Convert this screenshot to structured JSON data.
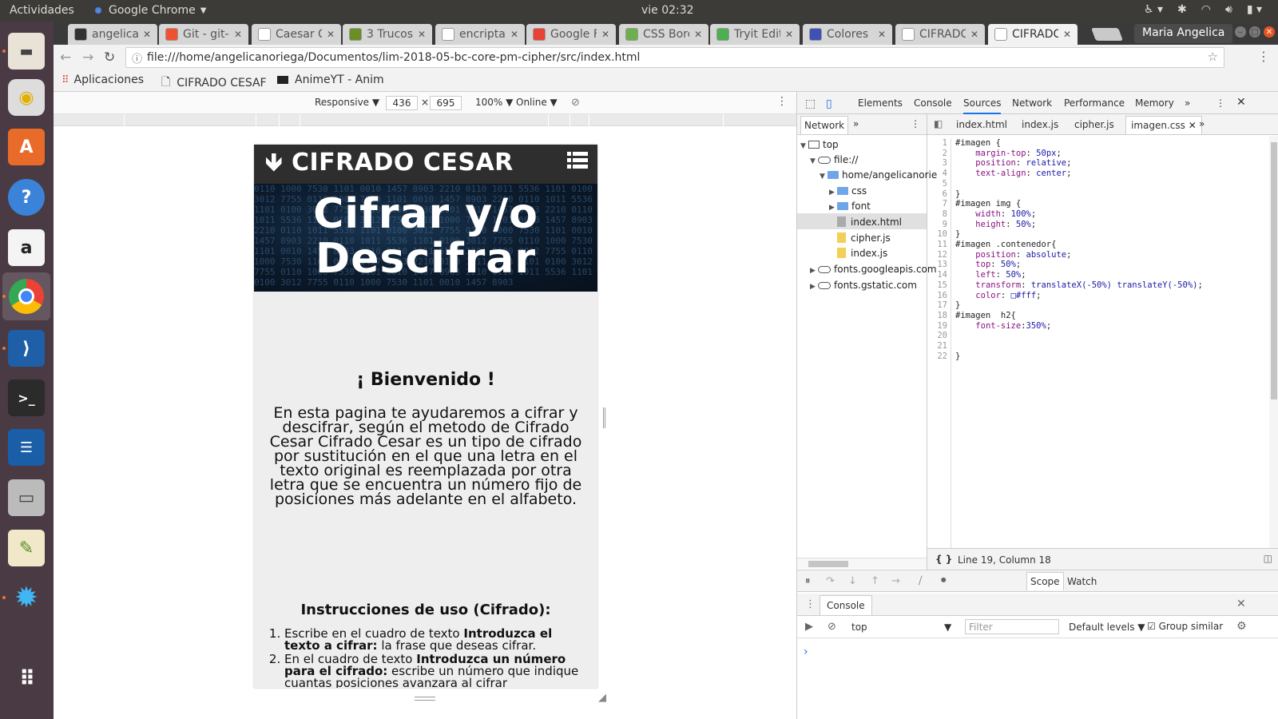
{
  "topbar": {
    "activities": "Actividades",
    "app_name": "Google Chrome",
    "clock": "vie 02:32"
  },
  "launcher": {
    "items": [
      "files-icon",
      "music-icon",
      "software-center-icon",
      "help-icon",
      "amazon-icon",
      "chrome-icon",
      "vscode-icon",
      "terminal-icon",
      "writer-icon",
      "scanner-icon",
      "image-viewer-icon",
      "settings-icon",
      "apps-grid-icon"
    ]
  },
  "tabs": [
    {
      "title": "angelica",
      "color": "#333333"
    },
    {
      "title": "Git - git-c",
      "color": "#f05133"
    },
    {
      "title": "Caesar C",
      "color": "#ffffff"
    },
    {
      "title": "3 Trucos",
      "color": "#6b8f23"
    },
    {
      "title": "encripta",
      "color": "#ffffff"
    },
    {
      "title": "Google F",
      "color": "#e94235"
    },
    {
      "title": "CSS Borc",
      "color": "#6ab04c"
    },
    {
      "title": "Tryit Edit",
      "color": "#4caf50"
    },
    {
      "title": "Colores",
      "color": "#3f51b5"
    },
    {
      "title": "CIFRADC",
      "color": "#ffffff"
    },
    {
      "title": "CIFRADC",
      "color": "#ffffff"
    }
  ],
  "user": "Maria Angelica",
  "address": "file:///home/angelicanoriega/Documentos/lim-2018-05-bc-core-pm-cipher/src/index.html",
  "bookmarks": {
    "apps": "Aplicaciones",
    "b1": "CIFRADO CESAF",
    "b2": "AnimeYT - Anim"
  },
  "devbar": {
    "mode": "Responsive",
    "width": "436",
    "times": "×",
    "height": "695",
    "zoom": "100%",
    "network": "Online"
  },
  "page": {
    "brand": "CIFRADO CESAR",
    "hero_line1": "Cifrar y/o",
    "hero_line2": "Descifrar",
    "welcome": "¡ Bienvenido !",
    "intro": "En esta pagina te ayudaremos a cifrar y descifrar, según el metodo de Cifrado Cesar Cifrado Cesar es un tipo de cifrado por sustitución en el que una letra en el texto original es reemplazada por otra letra que se encuentra un número fijo de posiciones más adelante en el alfabeto.",
    "instr_title": "Instrucciones de uso (Cifrado):",
    "step1_pre": "Escribe en el cuadro de texto ",
    "step1_bold": "Introduzca el texto a cifrar:",
    "step1_post": " la frase que deseas cifrar.",
    "step2_pre": "En el cuadro de texto ",
    "step2_bold": "Introduzca un número para el cifrado:",
    "step2_post": " escribe un número que indique cuantas posiciones avanzara al cifrar"
  },
  "devtools": {
    "tabs": [
      "Elements",
      "Console",
      "Sources",
      "Network",
      "Performance",
      "Memory"
    ],
    "selected_tab": "Sources",
    "navigator_label": "Network",
    "tree": {
      "top": "top",
      "file": "file://",
      "home": "home/angelicanorie",
      "css": "css",
      "font": "font",
      "index_html": "index.html",
      "cipher": "cipher.js",
      "index_js": "index.js",
      "gapis": "fonts.googleapis.com",
      "gstatic": "fonts.gstatic.com"
    },
    "editor_tabs": [
      "index.html",
      "index.js",
      "cipher.js",
      "imagen.css"
    ],
    "status": "Line 19, Column 18",
    "scope": "Scope",
    "watch": "Watch",
    "console_label": "Console",
    "context": "top",
    "filter_placeholder": "Filter",
    "levels": "Default levels",
    "group_similar": "Group similar",
    "prompt": "›"
  },
  "code_lines": [
    "#imagen {",
    "    margin-top: 50px;",
    "    position: relative;",
    "    text-align: center;",
    "",
    "}",
    "#imagen img {",
    "    width: 100%;",
    "    height: 50%;",
    "}",
    "#imagen .contenedor{",
    "    position: absolute;",
    "    top: 50%;",
    "    left: 50%;",
    "    transform: translateX(-50%) translateY(-50%);",
    "    color: □#fff;",
    "}",
    "#imagen  h2{",
    "    font-size:350%;",
    "",
    "",
    "}"
  ]
}
